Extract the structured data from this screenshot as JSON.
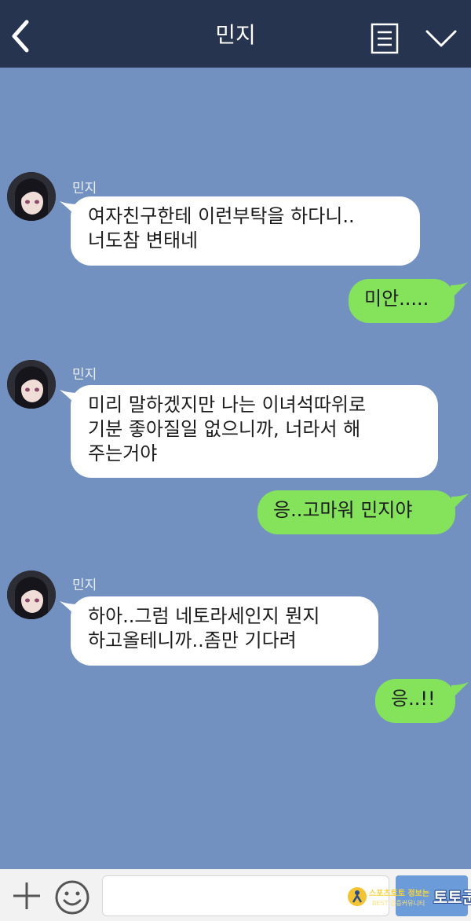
{
  "header": {
    "title": "민지"
  },
  "colors": {
    "header_bg": "#273450",
    "chat_bg": "#7391c0",
    "incoming_bubble": "#ffffff",
    "outgoing_bubble": "#84e25b"
  },
  "messages": [
    {
      "direction": "incoming",
      "sender": "민지",
      "text": "여자친구한테 이런부탁을 하다니..\n너도참 변태네"
    },
    {
      "direction": "outgoing",
      "text": "미안....."
    },
    {
      "direction": "incoming",
      "sender": "민지",
      "text": "미리 말하겠지만 나는 이녀석따위로\n기분 좋아질일 없으니까, 너라서 해\n주는거야"
    },
    {
      "direction": "outgoing",
      "text": "응..고마워 민지야"
    },
    {
      "direction": "incoming",
      "sender": "민지",
      "text": "하아..그럼 네토라세인지 뭔지\n하고올테니까..좀만 기다려"
    },
    {
      "direction": "outgoing",
      "text": "응..!!"
    }
  ],
  "input_bar": {
    "placeholder": ""
  },
  "watermark": {
    "line1": "스포츠토토 정보는",
    "line2": "BEST 검증커뮤니티",
    "brand": "토토군"
  },
  "icons": [
    "back-arrow-icon",
    "menu-list-icon",
    "chevron-down-icon",
    "plus-icon",
    "emoji-icon"
  ]
}
